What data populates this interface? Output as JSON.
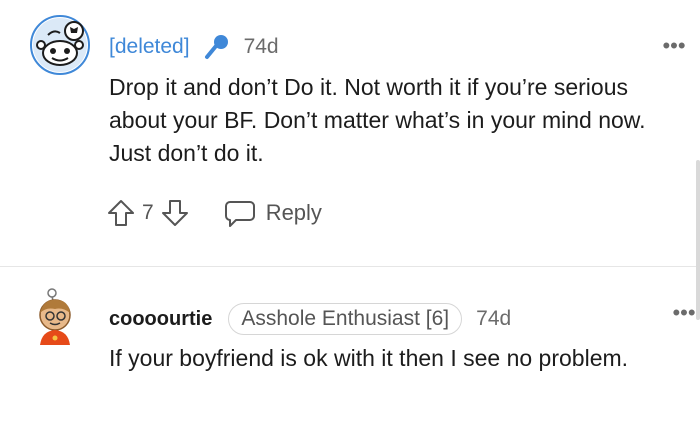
{
  "comments": [
    {
      "author": "[deleted]",
      "time": "74d",
      "text": "Drop it and don’t Do it. Not worth it if you’re serious about your BF. Don’t matter what’s in your mind now. Just don’t do it.",
      "score": "7",
      "reply_label": "Reply",
      "more_label": "•••"
    },
    {
      "author": "coooourtie",
      "flair": "Asshole Enthusiast [6]",
      "time": "74d",
      "text": "If your boyfriend is ok with it then I see no problem.",
      "more_label": "•••"
    }
  ],
  "colors": {
    "author_link": "#3f88d8",
    "meta": "#6b6b6b",
    "divider": "#e6e6e6"
  },
  "icons": [
    "snoo-avatar-icon",
    "microphone-icon",
    "upvote-icon",
    "downvote-icon",
    "reply-icon",
    "more-options-icon",
    "cartoon-avatar-icon"
  ]
}
